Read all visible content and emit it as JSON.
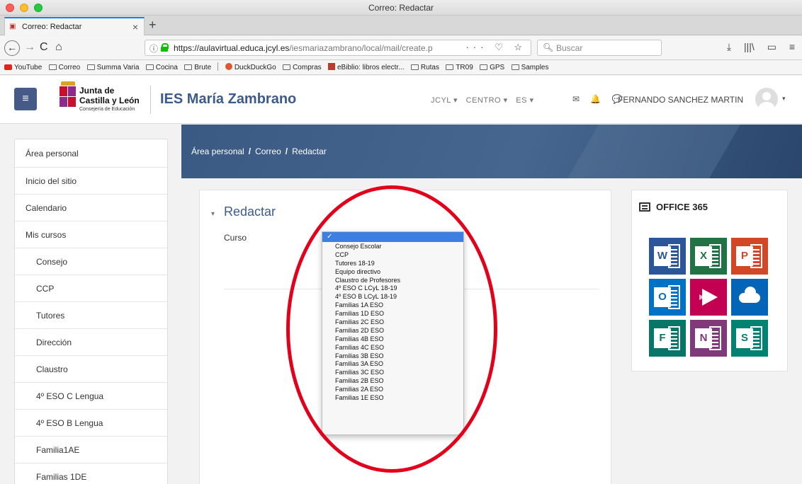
{
  "window": {
    "title": "Correo: Redactar"
  },
  "tab": {
    "title": "Correo: Redactar",
    "close": "×",
    "new": "+"
  },
  "nav": {
    "back": "←",
    "forward": "→",
    "reload": "C",
    "home": "⌂",
    "url_host": "https://aulavirtual.educa.jcyl.es",
    "url_path": "/iesmariazambrano/local/mail/create.p",
    "url_actions": "··· ♡ ☆",
    "search_placeholder": "Buscar",
    "tools": [
      "⤓",
      "|||\\",
      "▭",
      "≡"
    ]
  },
  "bookmarks": [
    {
      "label": "YouTube",
      "icon": "youtube-icon"
    },
    {
      "label": "Correo",
      "icon": "folder-icon"
    },
    {
      "label": "Summa Varia",
      "icon": "folder-icon"
    },
    {
      "label": "Cocina",
      "icon": "folder-icon"
    },
    {
      "label": "Brute",
      "icon": "folder-icon"
    },
    {
      "label": "DuckDuckGo",
      "icon": "duckduckgo-icon"
    },
    {
      "label": "Compras",
      "icon": "folder-icon"
    },
    {
      "label": "eBiblio: libros electr...",
      "icon": "ebiblio-icon"
    },
    {
      "label": "Rutas",
      "icon": "folder-icon"
    },
    {
      "label": "TR09",
      "icon": "folder-icon"
    },
    {
      "label": "GPS",
      "icon": "folder-icon"
    },
    {
      "label": "Samples",
      "icon": "folder-icon"
    }
  ],
  "header": {
    "menu_icon": "≡",
    "logo_line1": "Junta de",
    "logo_line2": "Castilla y León",
    "logo_line3": "Consejería de Educación",
    "site_name": "IES María Zambrano",
    "menus": [
      "JCYL ▾",
      "CENTRO ▾",
      "ES ▾"
    ],
    "icons": [
      "✉",
      "🔔",
      "💬"
    ],
    "user_name": "FERNANDO SANCHEZ MARTIN",
    "user_caret": "▾"
  },
  "sidebar": {
    "items": [
      {
        "label": "Área personal",
        "level": 0
      },
      {
        "label": "Inicio del sitio",
        "level": 0
      },
      {
        "label": "Calendario",
        "level": 0
      },
      {
        "label": "Mis cursos",
        "level": 0
      },
      {
        "label": "Consejo",
        "level": 1
      },
      {
        "label": "CCP",
        "level": 1
      },
      {
        "label": "Tutores",
        "level": 1
      },
      {
        "label": "Dirección",
        "level": 1
      },
      {
        "label": "Claustro",
        "level": 1
      },
      {
        "label": "4º ESO C Lengua",
        "level": 1
      },
      {
        "label": "4º ESO B Lengua",
        "level": 1
      },
      {
        "label": "Familia1AE",
        "level": 1
      },
      {
        "label": "Familias 1DE",
        "level": 1
      }
    ]
  },
  "breadcrumb": {
    "items": [
      "Área personal",
      "Correo",
      "Redactar"
    ],
    "separator": "/"
  },
  "compose": {
    "caret": "▾",
    "title": "Redactar",
    "course_label": "Curso",
    "selected_mark": "✓",
    "options": [
      "Consejo Escolar",
      "CCP",
      "Tutores 18-19",
      "Equipo directivo",
      "Claustro de Profesores",
      "4º ESO C LCyL 18-19",
      "4º ESO B LCyL 18-19",
      "Familias 1A ESO",
      "Familias 1D ESO",
      "Familias 2C ESO",
      "Familias 2D ESO",
      "Familias 4B ESO",
      "Familias 4C ESO",
      "Familias 3B ESO",
      "Familias 3A ESO",
      "Familias 3C ESO",
      "Familias 2B ESO",
      "Familias 2A ESO",
      "Familias 1E ESO"
    ]
  },
  "office": {
    "title": "OFFICE 365",
    "apps": [
      {
        "name": "word",
        "letter": "W",
        "color": "#2b579a"
      },
      {
        "name": "excel",
        "letter": "X",
        "color": "#217346"
      },
      {
        "name": "powerpoint",
        "letter": "P",
        "color": "#d24726"
      },
      {
        "name": "outlook",
        "letter": "O",
        "color": "#0072c6"
      },
      {
        "name": "stream",
        "letter": "",
        "color": "#c30052"
      },
      {
        "name": "onedrive",
        "letter": "",
        "color": "#0364b8"
      },
      {
        "name": "forms",
        "letter": "F",
        "color": "#077568"
      },
      {
        "name": "onenote",
        "letter": "N",
        "color": "#80397b"
      },
      {
        "name": "sway",
        "letter": "S",
        "color": "#008272"
      }
    ]
  },
  "colors": {
    "accent": "#3e5a8a",
    "annotation": "#e3001b",
    "selection": "#3d7fe0"
  }
}
